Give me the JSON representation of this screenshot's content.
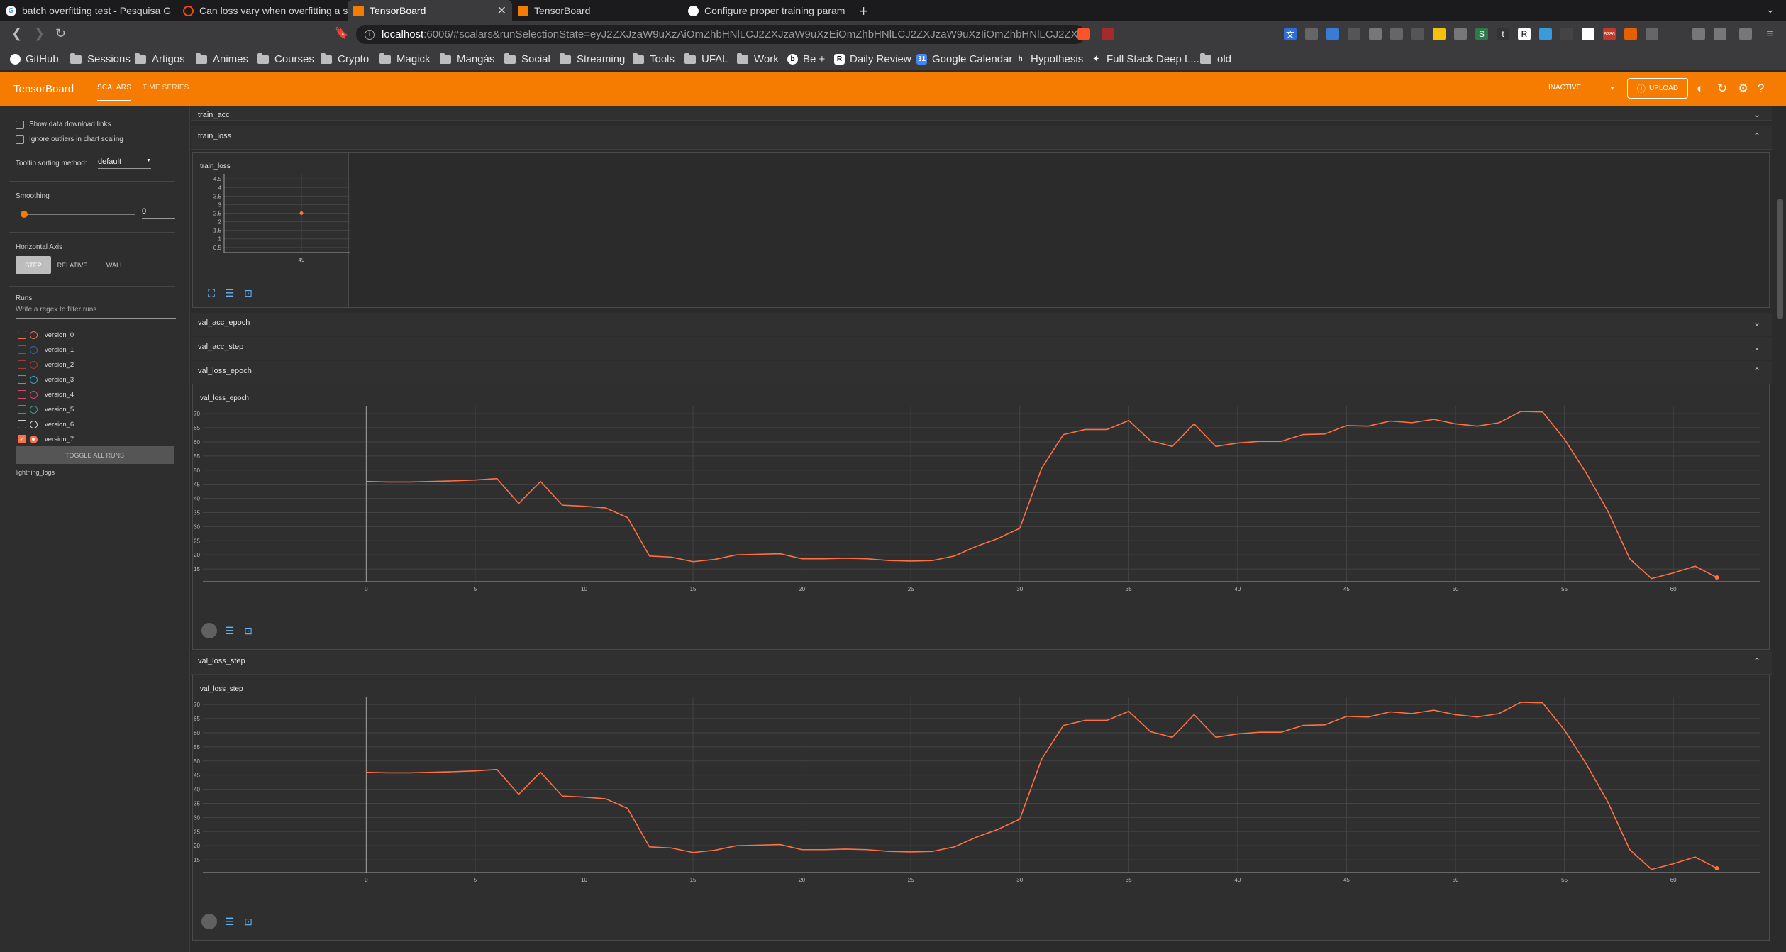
{
  "browser": {
    "tabs": [
      {
        "title": "batch overfitting test - Pesquisa G",
        "favicon": "google-icon",
        "active": false
      },
      {
        "title": "Can loss vary when overfitting a s",
        "favicon": "reddit-icon",
        "active": false
      },
      {
        "title": "TensorBoard",
        "favicon": "tensorboard-icon",
        "active": true
      },
      {
        "title": "TensorBoard",
        "favicon": "tensorboard-icon",
        "active": false
      },
      {
        "title": "Configure proper training param",
        "favicon": "github-icon",
        "active": false
      }
    ],
    "url_host": "localhost",
    "url_rest": ":6006/#scalars&runSelectionState=eyJ2ZXJzaW9uXzAiOmZhbHNlLCJ2ZXJzaW9uXzEiOmZhbHNlLCJ2ZXJzaW9uXzIiOmZhbHNlLCJ2ZXJ...",
    "brave_badge": "",
    "ext_badge": "8786",
    "bookmarks": [
      {
        "label": "GitHub",
        "icon": "github-icon"
      },
      {
        "label": "Sessions",
        "icon": "folder-icon"
      },
      {
        "label": "Artigos",
        "icon": "folder-icon"
      },
      {
        "label": "Animes",
        "icon": "folder-icon"
      },
      {
        "label": "Courses",
        "icon": "folder-icon"
      },
      {
        "label": "Crypto",
        "icon": "folder-icon"
      },
      {
        "label": "Magick",
        "icon": "folder-icon"
      },
      {
        "label": "Mangás",
        "icon": "folder-icon"
      },
      {
        "label": "Social",
        "icon": "folder-icon"
      },
      {
        "label": "Streaming",
        "icon": "folder-icon"
      },
      {
        "label": "Tools",
        "icon": "folder-icon"
      },
      {
        "label": "UFAL",
        "icon": "folder-icon"
      },
      {
        "label": "Work",
        "icon": "folder-icon"
      },
      {
        "label": "Be +",
        "icon": "behance-icon"
      },
      {
        "label": "Daily Review",
        "icon": "r-icon"
      },
      {
        "label": "Google Calendar",
        "icon": "calendar-icon"
      },
      {
        "label": "Hypothesis",
        "icon": "hypothesis-icon"
      },
      {
        "label": "Full Stack Deep L...",
        "icon": "fsdl-icon"
      },
      {
        "label": "old",
        "icon": "folder-icon"
      }
    ]
  },
  "tensorboard": {
    "logo": "TensorBoard",
    "tabs": [
      "SCALARS",
      "TIME SERIES"
    ],
    "reload_status": "INACTIVE",
    "upload_label": "UPLOAD"
  },
  "sidebar": {
    "show_download_links": "Show data download links",
    "ignore_outliers": "Ignore outliers in chart scaling",
    "tooltip_sorting_label": "Tooltip sorting method:",
    "tooltip_sorting_value": "default",
    "smoothing_label": "Smoothing",
    "smoothing_value": "0",
    "horizontal_axis_label": "Horizontal Axis",
    "axis_options": [
      "STEP",
      "RELATIVE",
      "WALL"
    ],
    "axis_selected": "STEP",
    "runs_label": "Runs",
    "runs_filter_placeholder": "Write a regex to filter runs",
    "runs": [
      {
        "name": "version_0",
        "color": "#e8704a",
        "checked": false
      },
      {
        "name": "version_1",
        "color": "#2d6aa8",
        "checked": false
      },
      {
        "name": "version_2",
        "color": "#a33a3a",
        "checked": false
      },
      {
        "name": "version_3",
        "color": "#29a9e0",
        "checked": false
      },
      {
        "name": "version_4",
        "color": "#d8466a",
        "checked": false
      },
      {
        "name": "version_5",
        "color": "#2a9d8f",
        "checked": false
      },
      {
        "name": "version_6",
        "color": "#cfcfcf",
        "checked": false
      },
      {
        "name": "version_7",
        "color": "#ff7043",
        "checked": true
      }
    ],
    "toggle_all": "TOGGLE ALL RUNS",
    "run_dir": "lightning_logs"
  },
  "main": {
    "groups": {
      "train_acc": "train_acc",
      "train_loss": "train_loss",
      "val_acc_epoch": "val_acc_epoch",
      "val_acc_step": "val_acc_step",
      "val_loss_epoch": "val_loss_epoch",
      "val_loss_step": "val_loss_step"
    }
  },
  "chart_data": [
    {
      "type": "scatter",
      "title": "train_loss",
      "series": [
        {
          "color": "#ff7043",
          "x": [
            49
          ],
          "y": [
            2.5
          ]
        }
      ],
      "x_ticks": [
        49
      ],
      "y_ticks": [
        0.5,
        1,
        1.5,
        2,
        2.5,
        3,
        3.5,
        4,
        4.5
      ],
      "ylim": [
        0.2,
        4.8
      ],
      "grid": true
    },
    {
      "type": "line",
      "title": "val_loss_epoch",
      "series": [
        {
          "color": "#ff7043",
          "x": [
            0,
            1,
            2,
            3,
            4,
            5,
            6,
            7,
            8,
            9,
            10,
            11,
            12,
            13,
            14,
            15,
            16,
            17,
            18,
            19,
            20,
            21,
            22,
            23,
            24,
            25,
            26,
            27,
            28,
            29,
            30,
            31,
            32,
            33,
            34,
            35,
            36,
            37,
            38,
            39,
            40,
            41,
            42,
            43,
            44,
            45,
            46,
            47,
            48,
            49,
            50,
            51,
            52,
            53,
            54,
            55,
            56,
            57,
            58,
            59,
            60,
            61,
            62
          ],
          "y": [
            46,
            45.8,
            45.8,
            46,
            46.2,
            46.5,
            47,
            38.2,
            46,
            37.6,
            37.2,
            36.6,
            33.2,
            19.6,
            19.2,
            17.6,
            18.4,
            20,
            20.2,
            20.4,
            18.6,
            18.6,
            18.8,
            18.6,
            18,
            17.8,
            18,
            19.6,
            23,
            25.8,
            29.4,
            50.6,
            62.6,
            64.4,
            64.4,
            67.6,
            60.4,
            58.4,
            66.4,
            58.4,
            59.6,
            60.2,
            60.2,
            62.6,
            62.8,
            65.8,
            65.6,
            67.4,
            66.8,
            68,
            66.4,
            65.6,
            66.8,
            70.8,
            70.6,
            61,
            49,
            35.4,
            18.6,
            11.6,
            13.6,
            16,
            12
          ]
        }
      ],
      "x_ticks": [
        0,
        5,
        10,
        15,
        20,
        25,
        30,
        35,
        40,
        45,
        50,
        55,
        60
      ],
      "y_ticks": [
        15,
        20,
        25,
        30,
        35,
        40,
        45,
        50,
        55,
        60,
        65,
        70
      ],
      "xlim": [
        -7.5,
        64
      ],
      "ylim": [
        10.5,
        72.8
      ],
      "grid": true
    },
    {
      "type": "line",
      "title": "val_loss_step",
      "series": [
        {
          "color": "#ff7043",
          "x": [
            0,
            1,
            2,
            3,
            4,
            5,
            6,
            7,
            8,
            9,
            10,
            11,
            12,
            13,
            14,
            15,
            16,
            17,
            18,
            19,
            20,
            21,
            22,
            23,
            24,
            25,
            26,
            27,
            28,
            29,
            30,
            31,
            32,
            33,
            34,
            35,
            36,
            37,
            38,
            39,
            40,
            41,
            42,
            43,
            44,
            45,
            46,
            47,
            48,
            49,
            50,
            51,
            52,
            53,
            54,
            55,
            56,
            57,
            58,
            59,
            60,
            61,
            62
          ],
          "y": [
            46,
            45.8,
            45.8,
            46,
            46.2,
            46.5,
            47,
            38.2,
            46,
            37.6,
            37.2,
            36.6,
            33.2,
            19.6,
            19.2,
            17.6,
            18.4,
            20,
            20.2,
            20.4,
            18.6,
            18.6,
            18.8,
            18.6,
            18,
            17.8,
            18,
            19.6,
            23,
            25.8,
            29.4,
            50.6,
            62.6,
            64.4,
            64.4,
            67.6,
            60.4,
            58.4,
            66.4,
            58.4,
            59.6,
            60.2,
            60.2,
            62.6,
            62.8,
            65.8,
            65.6,
            67.4,
            66.8,
            68,
            66.4,
            65.6,
            66.8,
            70.8,
            70.6,
            61,
            49,
            35.4,
            18.6,
            11.6,
            13.6,
            16,
            12
          ]
        }
      ],
      "x_ticks": [
        0,
        5,
        10,
        15,
        20,
        25,
        30,
        35,
        40,
        45,
        50,
        55,
        60
      ],
      "y_ticks": [
        15,
        20,
        25,
        30,
        35,
        40,
        45,
        50,
        55,
        60,
        65,
        70
      ],
      "xlim": [
        -7.5,
        64
      ],
      "ylim": [
        10.5,
        72.8
      ],
      "grid": true
    }
  ]
}
